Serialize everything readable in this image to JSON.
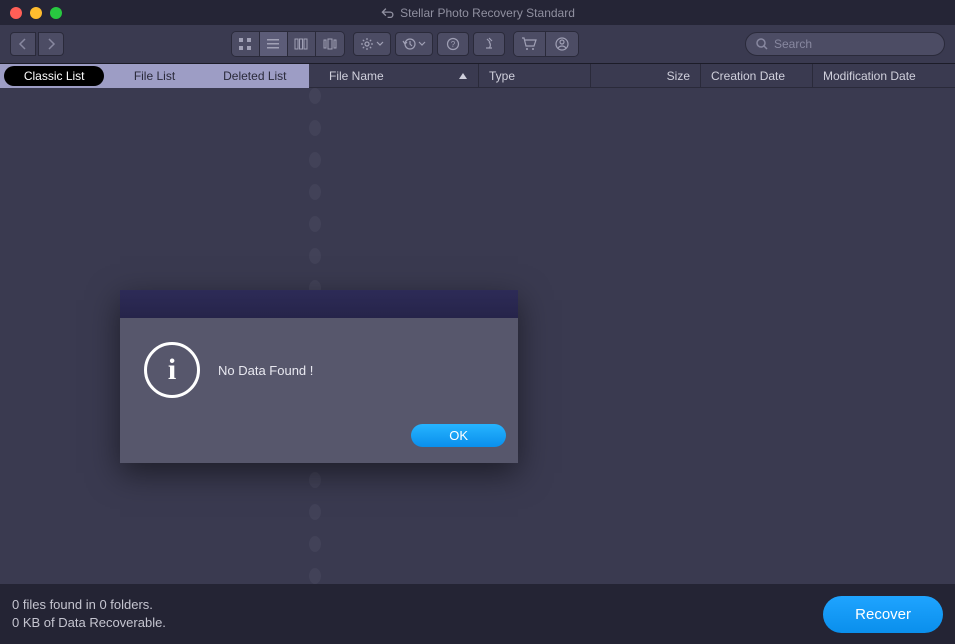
{
  "title": "Stellar Photo Recovery Standard",
  "search": {
    "placeholder": "Search"
  },
  "tabs": {
    "classic": "Classic List",
    "file": "File List",
    "deleted": "Deleted List"
  },
  "columns": {
    "filename": "File Name",
    "type": "Type",
    "size": "Size",
    "creation": "Creation Date",
    "modification": "Modification Date"
  },
  "dialog": {
    "message": "No Data Found !",
    "ok": "OK"
  },
  "status": {
    "line1": "0 files found in 0 folders.",
    "line2": "0  KB of Data Recoverable."
  },
  "recover": "Recover"
}
